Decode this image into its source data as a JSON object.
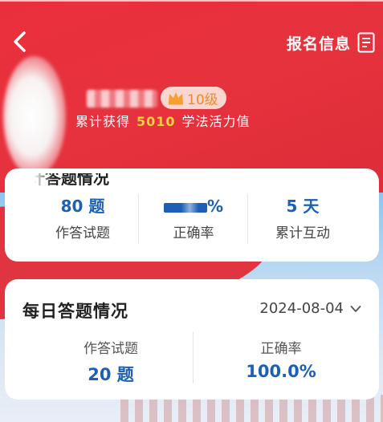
{
  "header": {
    "signup_info": "报名信息",
    "icons": {
      "back": "chevron-left-icon",
      "doc": "document-list-icon"
    }
  },
  "profile": {
    "level": "10级",
    "points_prefix": "累计获得",
    "points_value": "5010",
    "points_suffix": "学法活力值",
    "icons": {
      "badge": "crown-icon"
    }
  },
  "cumulative": {
    "title": "计答题情况",
    "stats": [
      {
        "value": "80 题",
        "label": "作答试题"
      },
      {
        "value": "%",
        "label": "正确率"
      },
      {
        "value": "5 天",
        "label": "累计互动"
      }
    ]
  },
  "daily": {
    "title": "每日答题情况",
    "date": "2024-08-04",
    "stats": [
      {
        "label": "作答试题",
        "value": "20 题"
      },
      {
        "label": "正确率",
        "value": "100.0%"
      }
    ]
  },
  "colors": {
    "brand_red": "#e6323d",
    "accent_blue": "#1c5fb5",
    "points_yellow": "#ffd23a",
    "level_orange": "#f08a2a"
  }
}
